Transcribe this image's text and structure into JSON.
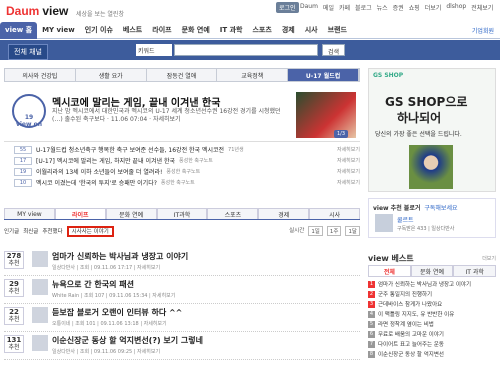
{
  "header": {
    "logo_daum": "Daum",
    "logo_view": "view",
    "tagline": "세상을 보는 열린창",
    "login": "로그인",
    "links": [
      "Daum",
      "메일",
      "카페",
      "블로그",
      "뉴스",
      "증권",
      "쇼핑",
      "더보기",
      "dlshop",
      "전체보기"
    ]
  },
  "nav": {
    "tabs": [
      "view 홈",
      "MY view",
      "인기 이슈",
      "베스트",
      "라이프",
      "문화 연예",
      "IT 과학",
      "스포츠",
      "경제",
      "시사",
      "브랜드"
    ],
    "right": "기업회원"
  },
  "search": {
    "all_label": "전체 채널",
    "select": "키워드",
    "button": "검색"
  },
  "section_tabs": [
    "의사와 건강팁",
    "생활 요가",
    "잠동건 열애",
    "교육정책",
    "U-17 월드컵"
  ],
  "featured": {
    "badge_count": "19",
    "badge_label": "view on",
    "title": "멕시코에 말리는 게임, 끝내 이겨낸 한국",
    "desc": "지난 밤 멕시코에서 대한민국과 멕시코의 U-17 세계 청소년선수권 16강전 경기를 시청했던 (…) 출수된 축구보다 · 11.06 07:04 · 자세히보기",
    "pager": "1/3"
  },
  "news": [
    {
      "num": "55",
      "title": "U-17월드컵 청소년축구 행복한 축구 보여준 선수들, 16강전 한국 멕시코전",
      "src": "71년생",
      "more": "자세히보기"
    },
    {
      "num": "17",
      "title": "[U-17] 멕시코에 말리는 게임, 하지만 끝내 이겨낸 한국",
      "src": "풍성한 축구노트",
      "more": "자세히보기"
    },
    {
      "num": "19",
      "title": "이월리라의 13세 이하 소년들이 보여줄 더 열려라!",
      "src": "풍성한 축구노트",
      "more": "자세히보기"
    },
    {
      "num": "10",
      "title": "멕시코 이겼는데 '한국의 투지'로 승패만 이기다?",
      "src": "풍성한 축구노트",
      "more": "자세히보기"
    }
  ],
  "lower_tabs": [
    "MY view",
    "라이프",
    "문화 연예",
    "IT과학",
    "스포츠",
    "경제",
    "시사"
  ],
  "subrow": {
    "left1": "인기글",
    "left2": "최신글",
    "left3": "추천했다",
    "highlight": "시사사는 이야기",
    "right": [
      "실시간",
      "1일",
      "1주",
      "1달"
    ]
  },
  "articles": [
    {
      "count": "278",
      "unit": "추천",
      "title": "엄마가 신뢰하는 박사님과 냉장고 이야기",
      "meta": "일상다반사 | 조회 | 09.11.06 17:17 | 자세히보기"
    },
    {
      "count": "29",
      "unit": "추천",
      "title": "뉴욕으로 간 한국의 패션",
      "meta": "White Rain | 조회 107 | 09.11.06 15:34 | 자세히보기"
    },
    {
      "count": "22",
      "unit": "추천",
      "title": "듣보잡 블로거 오랜이 인터뷰 하다 ^^",
      "meta": "오통이네 | 조회 101 | 09.11.06 13:18 | 자세히보기"
    },
    {
      "count": "131",
      "unit": "추천",
      "title": "이순신장군 동상 할 억지변선(?) 보기 그렇네",
      "meta": "일상다반사 | 조회 | 09.11.06 09:25 | 자세히보기"
    }
  ],
  "ad": {
    "logo": "GS SHOP",
    "line1": "GS SHOP으로",
    "line2": "하나되어",
    "sub": "당신의 가장 좋은 선택을 드립니다."
  },
  "reviewer": {
    "head": "view 추천 블로거",
    "link": "구독해보세요",
    "name": "쿨르트",
    "meta": "구독받은 433 | 일상다반사"
  },
  "best": {
    "head": "view 베스트",
    "more": "더보기",
    "tabs": [
      "전체",
      "문화 연예",
      "IT 과학"
    ],
    "items": [
      "엄마가 신뢰하는 박사님과 냉장고 이야기",
      "군주 통일지의 진행하기",
      "근데바이스 참게가 나왔아요",
      "이 맥틀링 지지도, 유 반반한 이유",
      "라면 정착계 옆이는 비법",
      "무료로 배움의 고마운 이야기",
      "다이어트 표고 늘어주는 운동",
      "이순신장군 동상 할 억지변선"
    ]
  }
}
